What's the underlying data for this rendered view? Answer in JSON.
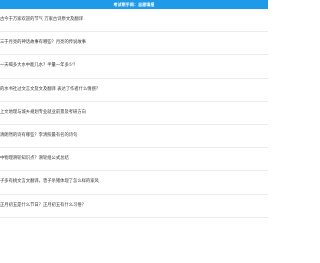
{
  "header": {
    "title": "考试帮手网：志愿填报"
  },
  "articles": [
    "古今于万家欢迎的节气 万家古诗原文及翻译",
    "三于月亮的神话故事有哪些？月亮的传说故事",
    "一天喝多大水中能几水？半量一年多少？",
    "的水书社过文言文及文及翻译 表达了作者什么情感？",
    "上文地理与城乡规划专业就业前景及考研方向",
    "清朗然的诗有哪些？李清照最有名的诗句",
    "中物理滑轮知识点？滑轮组公式总结",
    "子多有桃文言文翻译，曾子杀猪体现了怎么样的家风",
    "正月初五是什么节日？正月初五有什么习俗？"
  ]
}
